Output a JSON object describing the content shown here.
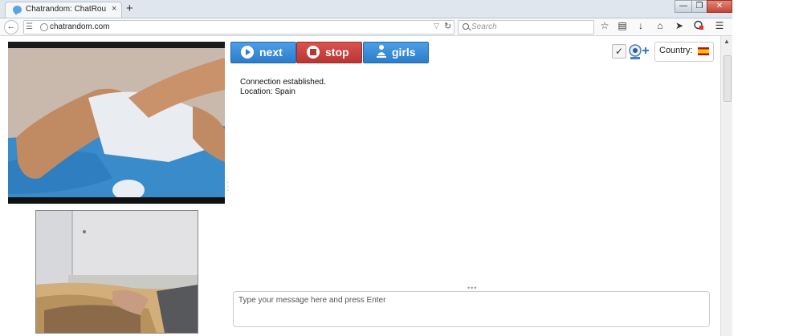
{
  "browser": {
    "tab_title": "Chatrandom: ChatRoulette…",
    "tab_close": "×",
    "new_tab": "+",
    "window_controls": [
      "—",
      "❐",
      "✕"
    ],
    "url": "chatrandom.com",
    "search_placeholder": "Search"
  },
  "page": {
    "buttons": {
      "next": "next",
      "stop": "stop",
      "girls": "girls"
    },
    "country_label": "Country:",
    "country_flag": "spain-flag",
    "chat_log": [
      "Connection established.",
      "Location: Spain"
    ],
    "message_placeholder": "Type your message here and press Enter"
  },
  "colors": {
    "next_button": "#2c7cc8",
    "stop_button": "#b83632",
    "girls_button": "#2c7cc8"
  }
}
